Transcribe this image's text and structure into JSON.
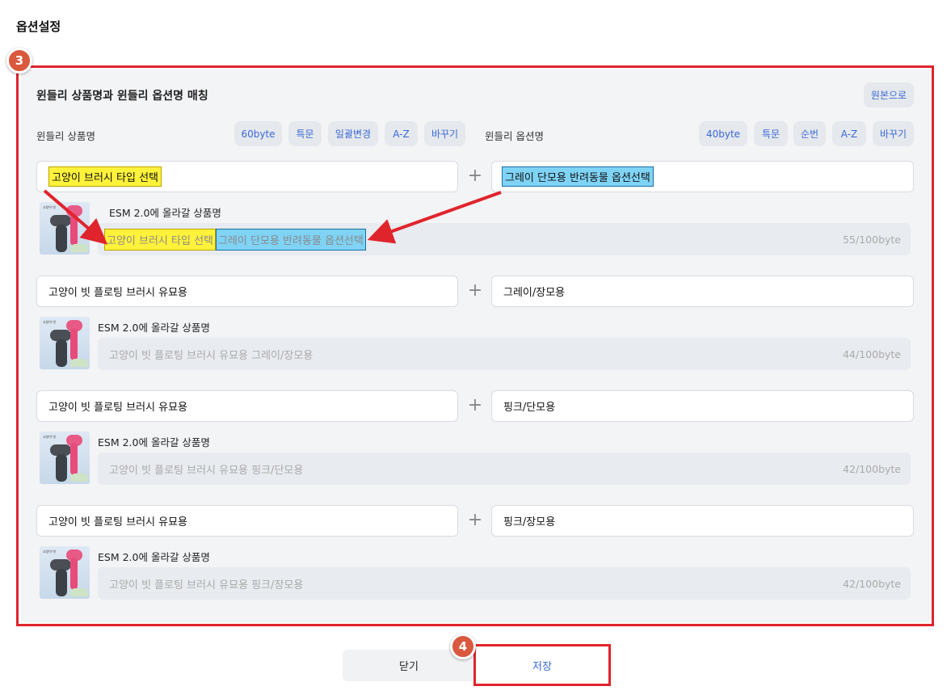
{
  "page_title": "옵션설정",
  "steps": {
    "panel": "3",
    "save": "4"
  },
  "section_title": "윈들리 상품명과 윈들리 옵션명 매칭",
  "reset_label": "원본으로",
  "product_name_label": "윈들리 상품명",
  "product_name_tools": [
    "60byte",
    "특문",
    "일괄변경",
    "A-Z",
    "바꾸기"
  ],
  "option_name_label": "윈들리 옵션명",
  "option_name_tools": [
    "40byte",
    "특문",
    "순번",
    "A-Z",
    "바꾸기"
  ],
  "esm_label": "ESM 2.0에 올라갈 상품명",
  "rows": [
    {
      "product": "고양이 브러시 타입 선택",
      "option": "그레이 단모용 반려동물 옵션선택",
      "preview_product": "고양이 브러시 타입 선택",
      "preview_option": "그레이 단모용 반려동물 옵션선택",
      "count": "55/100byte"
    },
    {
      "product": "고양이 빗 플로팅 브러시 유묘용",
      "option": "그레이/장모용",
      "preview": "고양이 빗 플로팅 브러시 유묘용 그레이/장모용",
      "count": "44/100byte"
    },
    {
      "product": "고양이 빗 플로팅 브러시 유묘용",
      "option": "핑크/단모용",
      "preview": "고양이 빗 플로팅 브러시 유묘용 핑크/단모용",
      "count": "42/100byte"
    },
    {
      "product": "고양이 빗 플로팅 브러시 유묘용",
      "option": "핑크/장모용",
      "preview": "고양이 빗 플로팅 브러시 유묘용 핑크/장모용",
      "count": "42/100byte"
    }
  ],
  "plus_symbol": "+",
  "thumb_text": "고양이 빗",
  "close_label": "닫기",
  "save_label": "저장",
  "colors": {
    "highlight_box": "#e0242c",
    "step_badge": "#d9583e",
    "chip_text": "#3a68d8",
    "highlight_yellow": "#fff23a",
    "highlight_blue": "#7fd3f5"
  }
}
